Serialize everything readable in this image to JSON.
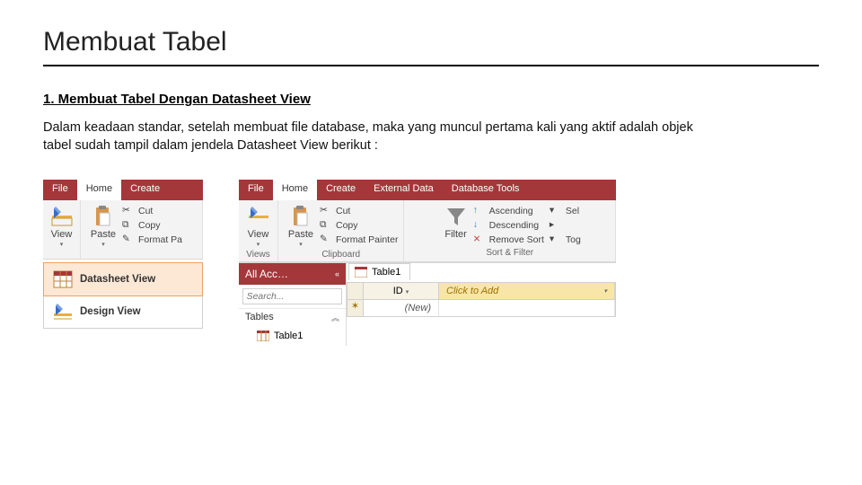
{
  "title": "Membuat Tabel",
  "subtitle": "1. Membuat Tabel Dengan Datasheet View",
  "para": "Dalam keadaan standar, setelah membuat file database, maka yang muncul pertama kali yang aktif adalah objek tabel sudah tampil dalam jendela Datasheet View berikut :",
  "tabs": {
    "file": "File",
    "home": "Home",
    "create": "Create",
    "ext": "External Data",
    "db": "Database Tools"
  },
  "btn": {
    "view": "View",
    "paste": "Paste",
    "cut": "Cut",
    "copy": "Copy",
    "formatpa": "Format Pa",
    "formatpainter": "Format Painter",
    "filter": "Filter",
    "asc": "Ascending",
    "desc": "Descending",
    "remove": "Remove Sort",
    "sel": "Sel",
    "tog": "Tog"
  },
  "grp": {
    "views": "Views",
    "clipboard": "Clipboard",
    "sortfilter": "Sort & Filter"
  },
  "menu": {
    "datasheet": "Datasheet View",
    "design": "Design View"
  },
  "nav": {
    "header": "All Acc…",
    "search_ph": "Search...",
    "tables": "Tables",
    "table1": "Table1"
  },
  "ds": {
    "tab": "Table1",
    "id": "ID",
    "add": "Click to Add",
    "new": "(New)"
  }
}
